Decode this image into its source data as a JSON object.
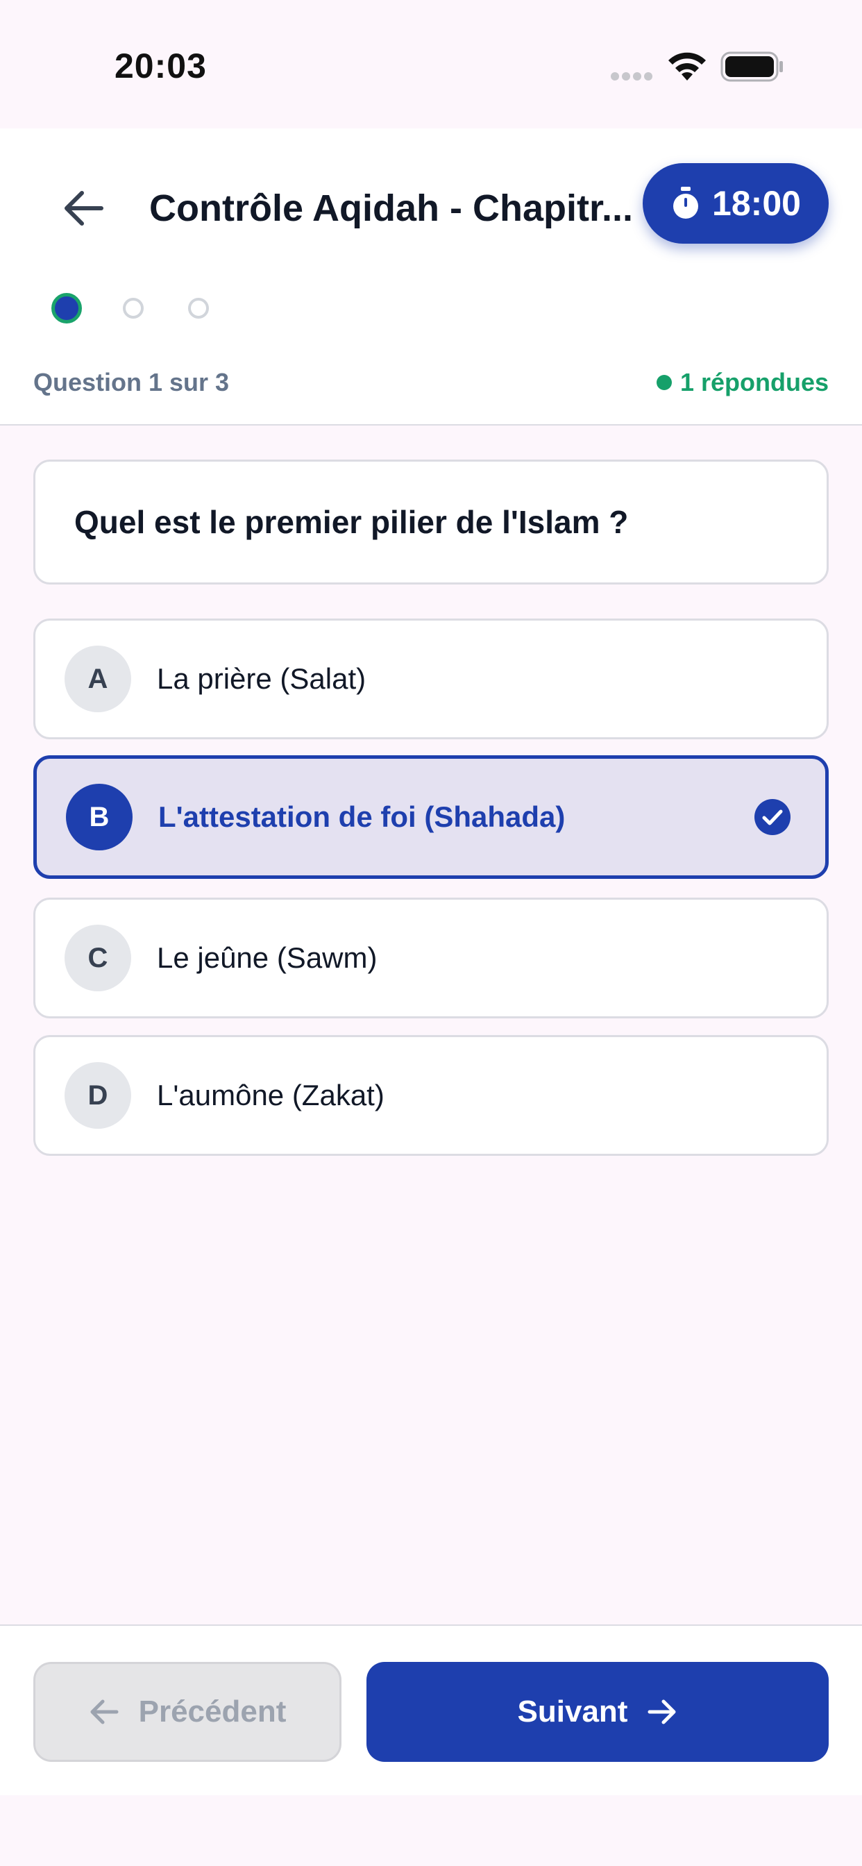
{
  "status_bar": {
    "time": "20:03"
  },
  "header": {
    "title": "Contrôle Aqidah - Chapitr...",
    "timer": "18:00",
    "question_counter": "Question 1 sur 3",
    "answered": "1 répondues"
  },
  "question": {
    "text": "Quel est le premier pilier de l'Islam ?",
    "options": [
      {
        "letter": "A",
        "text": "La prière (Salat)",
        "selected": false
      },
      {
        "letter": "B",
        "text": "L'attestation de foi (Shahada)",
        "selected": true
      },
      {
        "letter": "C",
        "text": "Le jeûne (Sawm)",
        "selected": false
      },
      {
        "letter": "D",
        "text": "L'aumône (Zakat)",
        "selected": false
      }
    ]
  },
  "footer": {
    "prev_label": "Précédent",
    "next_label": "Suivant"
  },
  "colors": {
    "primary": "#1e3fae",
    "success": "#16a06a",
    "background": "#fdf6fc"
  }
}
